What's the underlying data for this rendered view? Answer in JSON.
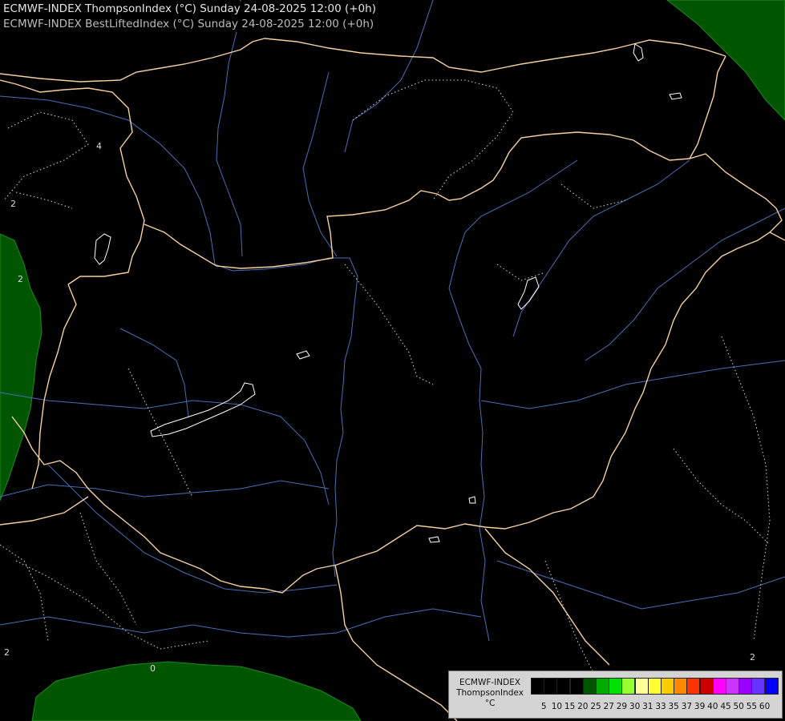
{
  "header": {
    "line1": "ECMWF-INDEX ThompsonIndex (°C) Sunday 24-08-2025 12:00 (+0h)",
    "line2": "ECMWF-INDEX BestLiftedIndex (°C) Sunday 24-08-2025 12:00 (+0h)"
  },
  "legend": {
    "line1": "ECMWF-INDEX",
    "line2": "ThompsonIndex",
    "unit": "°C",
    "swatch_colors": [
      "#000000",
      "#000000",
      "#000000",
      "#000000",
      "#005500",
      "#00aa00",
      "#00e000",
      "#99ff33",
      "#ffff99",
      "#ffff33",
      "#ffcc00",
      "#ff8800",
      "#ff3300",
      "#cc0000",
      "#ff00ff",
      "#cc33ff",
      "#9900ff",
      "#6633ff",
      "#0000ff"
    ],
    "ticks": [
      "5",
      "10",
      "15",
      "20",
      "25",
      "27",
      "29",
      "30",
      "31",
      "33",
      "35",
      "37",
      "39",
      "40",
      "45",
      "50",
      "55",
      "60"
    ]
  },
  "contour_labels": [
    "2",
    "2",
    "4",
    "2",
    "2",
    "0"
  ],
  "colors": {
    "land": "#000000",
    "green_zone": "#005500",
    "borders": "#f5d0a0",
    "rivers": "#4a6fb5",
    "contours": "#d8d8d8"
  }
}
